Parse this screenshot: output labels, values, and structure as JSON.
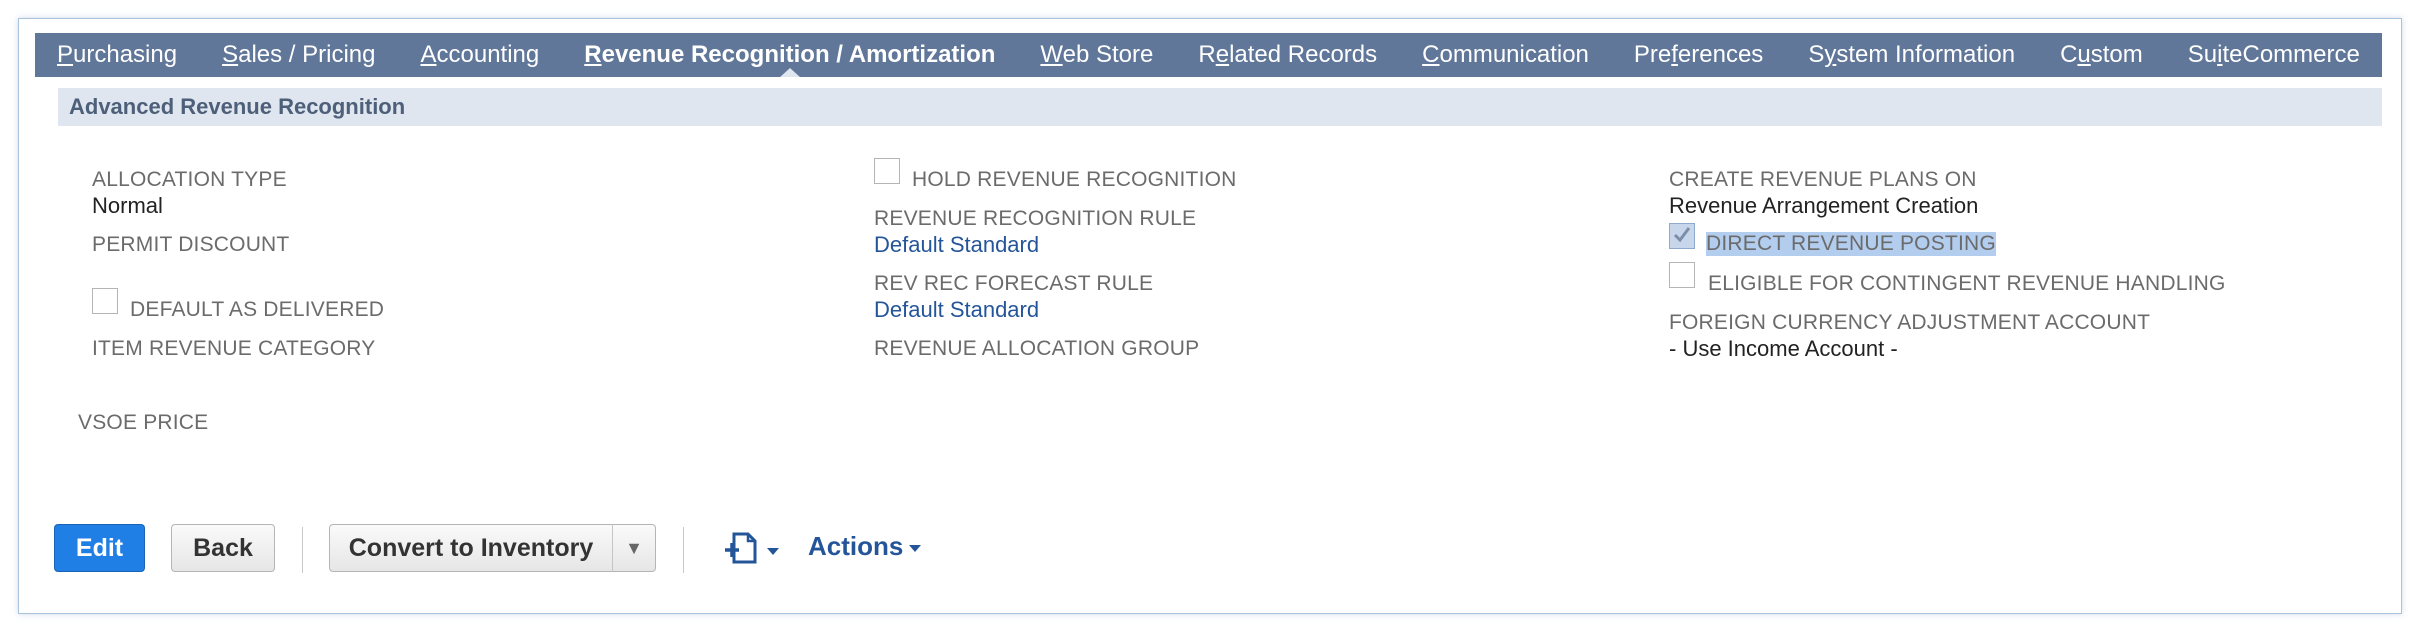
{
  "tabs": [
    {
      "pre": "",
      "u": "P",
      "post": "urchasing"
    },
    {
      "pre": "",
      "u": "S",
      "post": "ales / Pricing"
    },
    {
      "pre": "",
      "u": "A",
      "post": "ccounting"
    },
    {
      "pre": "",
      "u": "R",
      "post": "evenue Recognition / Amortization"
    },
    {
      "pre": "",
      "u": "W",
      "post": "eb Store"
    },
    {
      "pre": "R",
      "u": "e",
      "post": "lated Records"
    },
    {
      "pre": "",
      "u": "C",
      "post": "ommunication"
    },
    {
      "pre": "Pre",
      "u": "f",
      "post": "erences"
    },
    {
      "pre": "S",
      "u": "y",
      "post": "stem Information"
    },
    {
      "pre": "C",
      "u": "u",
      "post": "stom"
    },
    {
      "pre": "Su",
      "u": "i",
      "post": "teCommerce"
    }
  ],
  "section": {
    "title": "Advanced Revenue Recognition"
  },
  "fields": {
    "allocation_type_label": "ALLOCATION TYPE",
    "allocation_type_value": "Normal",
    "permit_discount_label": "PERMIT DISCOUNT",
    "default_as_delivered_label": "DEFAULT AS DELIVERED",
    "item_revenue_category_label": "ITEM REVENUE CATEGORY",
    "vsoe_price_label": "VSOE PRICE",
    "hold_rev_rec_label": "HOLD REVENUE RECOGNITION",
    "rev_rec_rule_label": "REVENUE RECOGNITION RULE",
    "rev_rec_rule_value": "Default Standard",
    "rev_rec_forecast_label": "REV REC FORECAST RULE",
    "rev_rec_forecast_value": "Default Standard",
    "rev_alloc_group_label": "REVENUE ALLOCATION GROUP",
    "create_plans_label": "CREATE REVENUE PLANS ON",
    "create_plans_value": "Revenue Arrangement Creation",
    "direct_posting_label": "DIRECT REVENUE POSTING",
    "eligible_contingent_label": "ELIGIBLE FOR CONTINGENT REVENUE HANDLING",
    "fx_adjust_label": "FOREIGN CURRENCY ADJUSTMENT ACCOUNT",
    "fx_adjust_value": "- Use Income Account -"
  },
  "buttons": {
    "edit": "Edit",
    "back": "Back",
    "convert": "Convert to Inventory",
    "actions": "Actions"
  },
  "icons": {
    "new_record": "new-document-icon",
    "dropdown": "triangle-down-icon"
  },
  "colors": {
    "tabbar": "#607799",
    "section": "#e0e6ef",
    "primary": "#1f7fe5",
    "link": "#255599"
  }
}
